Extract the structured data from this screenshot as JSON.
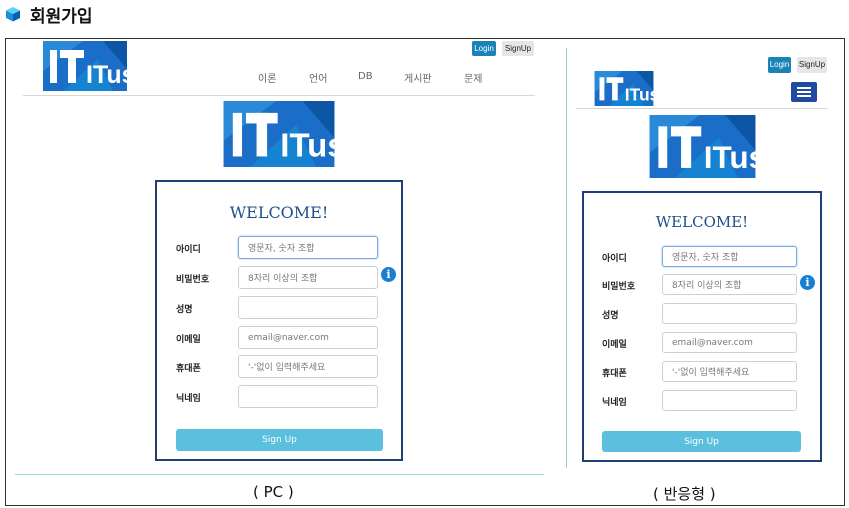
{
  "page": {
    "heading": "회원가입",
    "caption_pc": "( PC )",
    "caption_mobile": "( 반응형 )"
  },
  "header": {
    "login_label": "Login",
    "signup_label": "SignUp",
    "logo_text": "ITus"
  },
  "nav": {
    "items": [
      "이론",
      "언어",
      "DB",
      "게시판",
      "문제"
    ]
  },
  "form": {
    "welcome": "WELCOME!",
    "fields": [
      {
        "label": "아이디",
        "placeholder": "영문자, 숫자 조합",
        "focused": true,
        "info": false
      },
      {
        "label": "비밀번호",
        "placeholder": "8자리 이상의 조합",
        "focused": false,
        "info": true
      },
      {
        "label": "성명",
        "placeholder": "",
        "focused": false,
        "info": false
      },
      {
        "label": "이메일",
        "placeholder": "email@naver.com",
        "focused": false,
        "info": false
      },
      {
        "label": "휴대폰",
        "placeholder": "'-'없이 입력해주세요",
        "focused": false,
        "info": false
      },
      {
        "label": "닉네임",
        "placeholder": "",
        "focused": false,
        "info": false
      }
    ],
    "submit_label": "Sign Up",
    "info_glyph": "i"
  },
  "colors": {
    "brand_blue": "#1a6ec8",
    "card_border": "#1e3f78",
    "login_button": "#1a82b6",
    "submit_button": "#5bc0de",
    "welcome_text": "#1e4f88"
  }
}
